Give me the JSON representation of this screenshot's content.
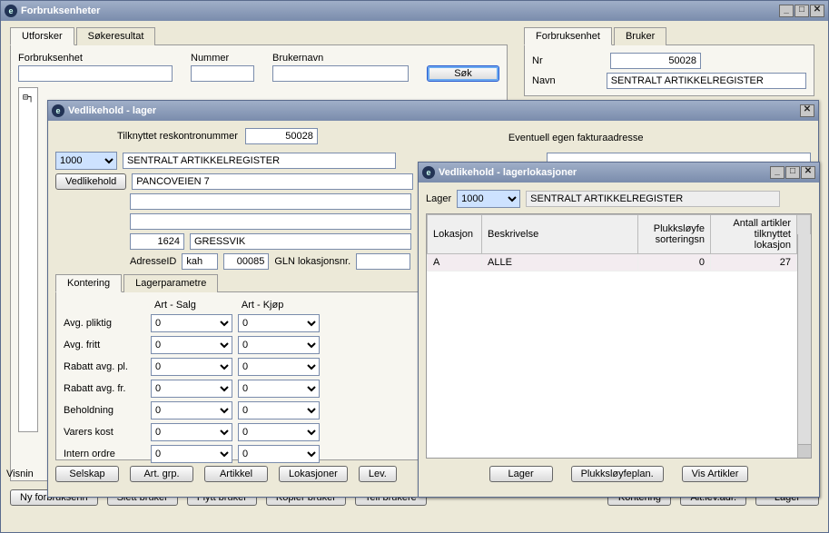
{
  "main": {
    "title": "Forbruksenheter",
    "tabs": {
      "t1": "Utforsker",
      "t2": "Søkeresultat"
    },
    "search": {
      "l_forbruk": "Forbruksenhet",
      "l_nummer": "Nummer",
      "l_bruker": "Brukernavn",
      "btn_sok": "Søk"
    },
    "visning_label": "Visnin",
    "right_tabs": {
      "t1": "Forbruksenhet",
      "t2": "Bruker"
    },
    "right": {
      "l_nr": "Nr",
      "nr": "50028",
      "l_navn": "Navn",
      "navn": "SENTRALT ARTIKKELREGISTER"
    },
    "bottom": {
      "b_ny": "Ny forbruksenh",
      "b_slett": "Slett bruker",
      "b_flytt": "Flytt bruker",
      "b_kopier": "Kopier bruker",
      "b_tell": "Tell brukere",
      "b_kontering": "Kontering",
      "b_alt": "Alt.lev.adr.",
      "b_lager": "Lager"
    }
  },
  "v1": {
    "title": "Vedlikehold - lager",
    "l_reskontro": "Tilknyttet reskontronummer",
    "reskontro": "50028",
    "sel_lager": "1000",
    "btn_vedlikehold": "Vedlikehold",
    "navn": "SENTRALT ARTIKKELREGISTER",
    "adresse": "PANCOVEIEN 7",
    "post": "1624",
    "sted": "GRESSVIK",
    "l_adresseid": "AdresseID",
    "adresseid": "kah",
    "adresseid2": "00085",
    "l_gln": "GLN lokasjonsnr.",
    "l_faktura": "Eventuell egen fakturaadresse",
    "tabs": {
      "t1": "Kontering",
      "t2": "Lagerparametre"
    },
    "kont": {
      "h_salg": "Art - Salg",
      "h_kjop": "Art - Kjøp",
      "r1": "Avg. pliktig",
      "r2": "Avg. fritt",
      "r3": "Rabatt avg. pl.",
      "r4": "Rabatt avg. fr.",
      "r5": "Beholdning",
      "r6": "Varers kost",
      "r7": "Intern ordre",
      "zero": "0"
    },
    "buttons": {
      "b1": "Selskap",
      "b2": "Art. grp.",
      "b3": "Artikkel",
      "b4": "Lokasjoner",
      "b5": "Lev."
    }
  },
  "v2": {
    "title": "Vedlikehold - lagerlokasjoner",
    "l_lager": "Lager",
    "sel": "1000",
    "navn": "SENTRALT ARTIKKELREGISTER",
    "cols": {
      "c1": "Lokasjon",
      "c2": "Beskrivelse",
      "c3": "Plukksløyfe sorteringsn",
      "c4": "Antall artikler tilknyttet lokasjon"
    },
    "row": {
      "lok": "A",
      "besk": "ALLE",
      "sort": "0",
      "ant": "27"
    },
    "buttons": {
      "b1": "Lager",
      "b2": "Plukksløyfeplan.",
      "b3": "Vis Artikler"
    }
  }
}
